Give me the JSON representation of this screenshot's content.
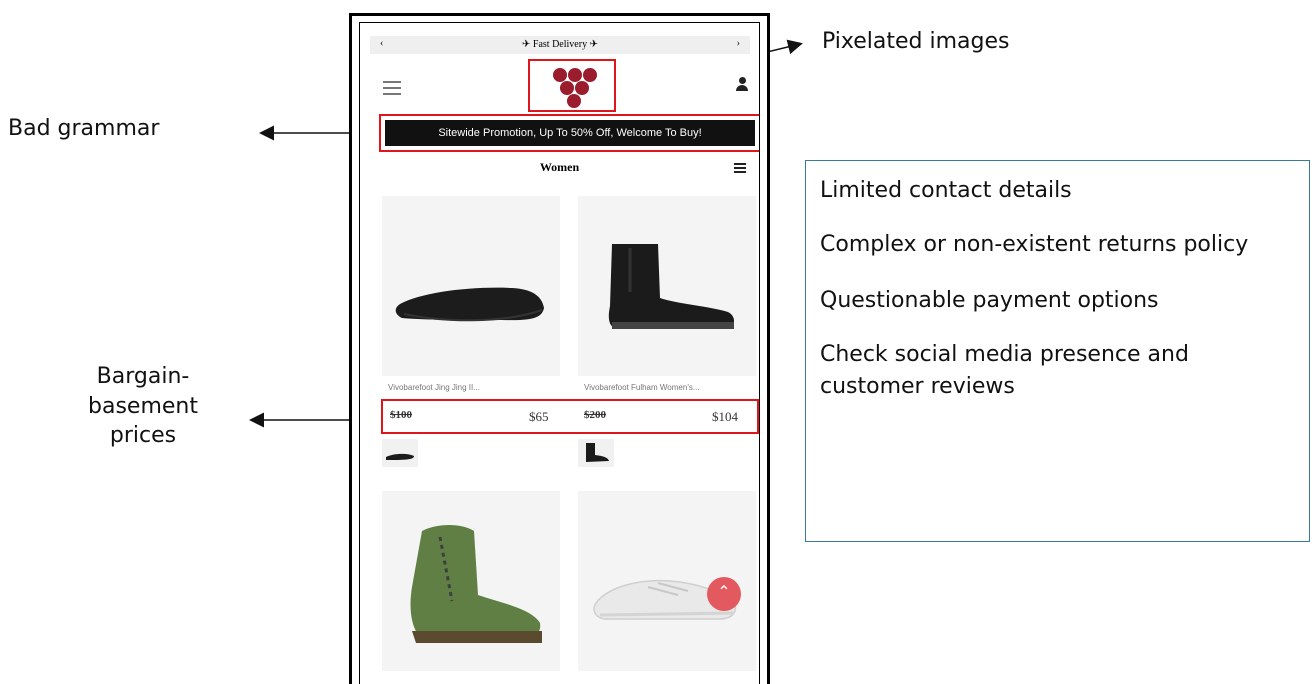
{
  "annotations": {
    "bad_grammar": "Bad grammar",
    "pixelated_images": "Pixelated images",
    "bargain_prices": "Bargain-\nbasement\nprices"
  },
  "checklist": [
    "Limited contact details",
    "Complex or non-existent returns policy",
    "Questionable payment options",
    "Check social media presence and customer reviews"
  ],
  "phone": {
    "topbar": {
      "left_arrow": "‹",
      "center": "✈ Fast Delivery ✈",
      "right_arrow": "›"
    },
    "promo_banner": "Sitewide Promotion, Up To 50% Off, Welcome To Buy!",
    "section_title": "Women",
    "products": [
      {
        "name": "Vivobarefoot Jing Jing II...",
        "old_price": "$100",
        "new_price": "$65"
      },
      {
        "name": "Vivobarefoot Fulham Women's...",
        "old_price": "$200",
        "new_price": "$104"
      }
    ],
    "back_to_top": "⌃"
  },
  "colors": {
    "highlight_red": "#e0151c",
    "info_box_border": "#3a7a96",
    "logo": "#9a1c2d",
    "boot_green": "#5f7f45"
  }
}
